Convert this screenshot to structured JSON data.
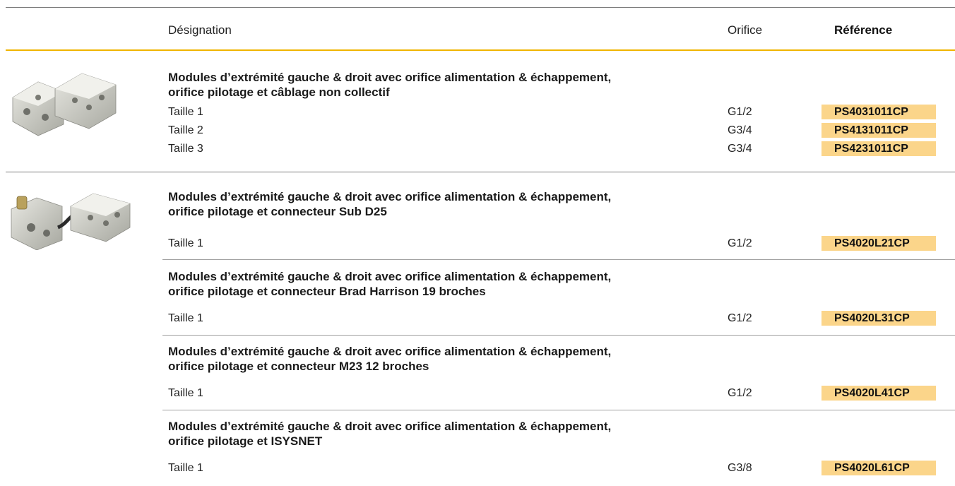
{
  "header": {
    "designation": "Désignation",
    "orifice": "Orifice",
    "reference": "Référence"
  },
  "groups": [
    {
      "title_line1": "Modules d’extrémité gauche & droit avec orifice alimentation & échappement,",
      "title_line2": "orifice pilotage et câblage non collectif",
      "rows": [
        {
          "size": "Taille 1",
          "port": "G1/2",
          "ref": "PS4031011CP"
        },
        {
          "size": "Taille 2",
          "port": "G3/4",
          "ref": "PS4131011CP"
        },
        {
          "size": "Taille 3",
          "port": "G3/4",
          "ref": "PS4231011CP"
        }
      ]
    },
    {
      "title_line1": "Modules d’extrémité gauche & droit avec orifice alimentation & échappement,",
      "title_line2": "orifice pilotage et connecteur Sub D25",
      "rows": [
        {
          "size": "Taille 1",
          "port": "G1/2",
          "ref": "PS4020L21CP"
        }
      ]
    },
    {
      "title_line1": "Modules d’extrémité gauche & droit avec orifice alimentation & échappement,",
      "title_line2": "orifice pilotage et connecteur Brad Harrison 19 broches",
      "rows": [
        {
          "size": "Taille 1",
          "port": "G1/2",
          "ref": "PS4020L31CP"
        }
      ]
    },
    {
      "title_line1": "Modules d’extrémité gauche & droit avec orifice alimentation & échappement,",
      "title_line2": "orifice pilotage et connecteur M23 12 broches",
      "rows": [
        {
          "size": "Taille 1",
          "port": "G1/2",
          "ref": "PS4020L41CP"
        }
      ]
    },
    {
      "title_line1": "Modules d’extrémité gauche & droit avec orifice alimentation & échappement,",
      "title_line2": "orifice pilotage et ISYSNET",
      "rows": [
        {
          "size": "Taille 1",
          "port": "G3/8",
          "ref": "PS4020L61CP"
        }
      ]
    }
  ],
  "colors": {
    "accent_line": "#f0b400",
    "reference_highlight": "#fbd58a"
  }
}
